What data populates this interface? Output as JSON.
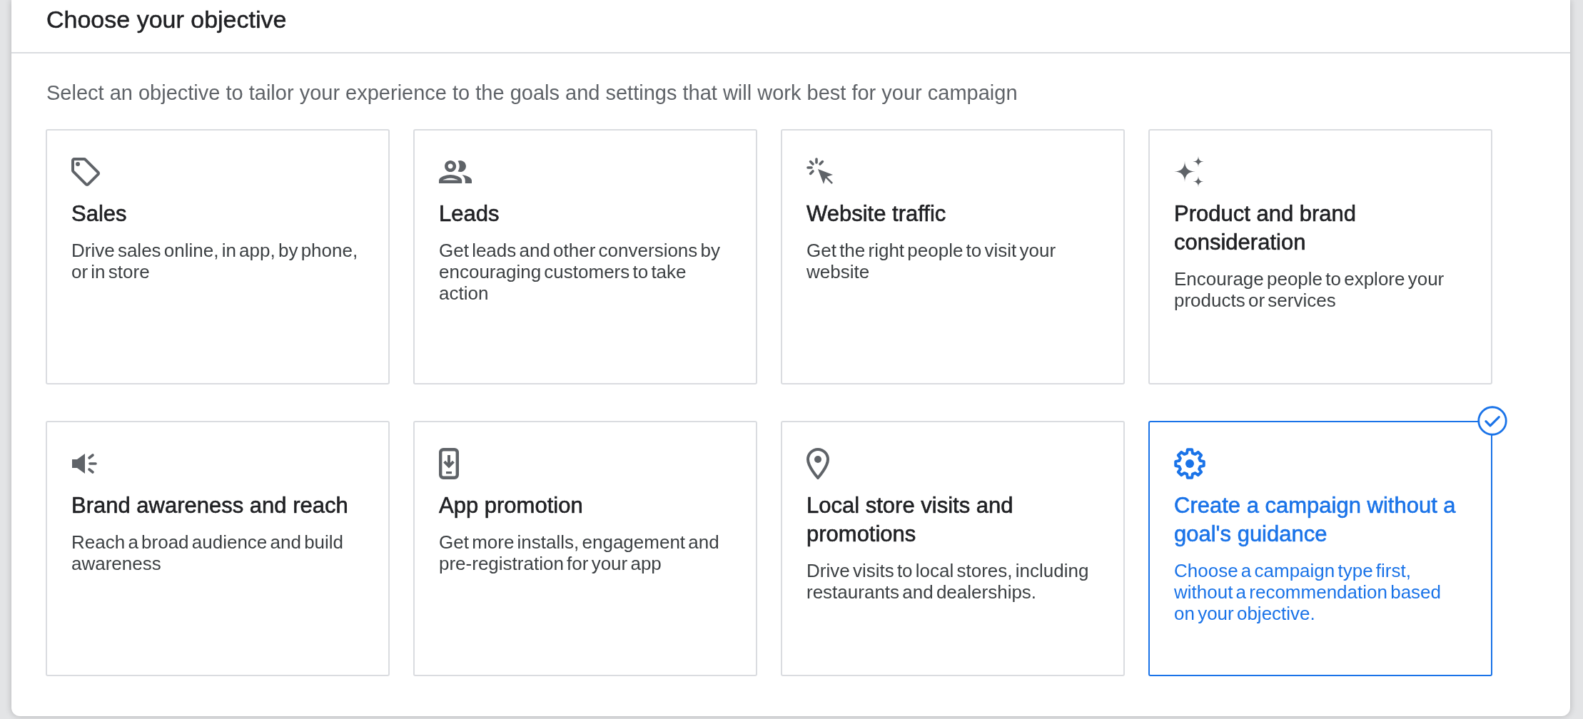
{
  "dialog": {
    "title": "Choose your objective",
    "subtitle": "Select an objective to tailor your experience to the goals and settings that will work best for your campaign"
  },
  "objectives": [
    {
      "title": "Sales",
      "description": "Drive sales online, in app, by phone, or in store",
      "selected": false
    },
    {
      "title": "Leads",
      "description": "Get leads and other conversions by encouraging customers to take action",
      "selected": false
    },
    {
      "title": "Website traffic",
      "description": "Get the right people to visit your website",
      "selected": false
    },
    {
      "title": "Product and brand consideration",
      "description": "Encourage people to explore your products or services",
      "selected": false
    },
    {
      "title": "Brand awareness and reach",
      "description": "Reach a broad audience and build awareness",
      "selected": false
    },
    {
      "title": "App promotion",
      "description": "Get more installs, engagement and pre-registration for your app",
      "selected": false
    },
    {
      "title": "Local store visits and promotions",
      "description": "Drive visits to local stores, including restaurants and dealerships.",
      "selected": false
    },
    {
      "title": "Create a campaign without a goal's guidance",
      "description": "Choose a campaign type first, without a recommendation based on your objective.",
      "selected": true
    }
  ]
}
